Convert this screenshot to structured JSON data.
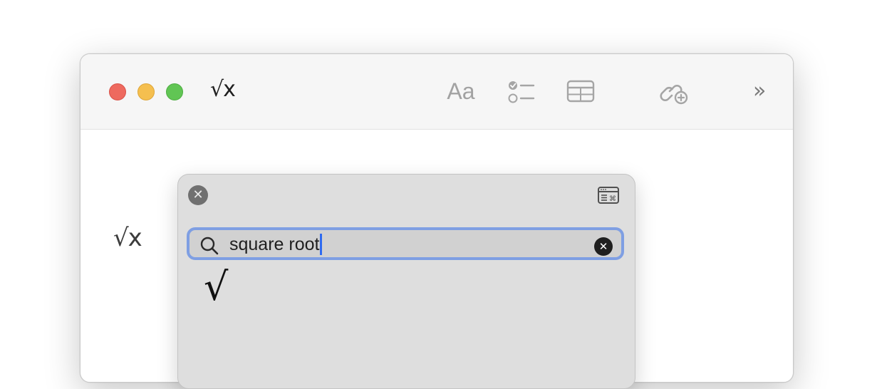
{
  "window": {
    "title": "√x",
    "traffic_lights": [
      "close",
      "minimize",
      "zoom"
    ]
  },
  "toolbar": {
    "text_style_label": "Aa",
    "icons": [
      "text-format-icon",
      "checklist-icon",
      "table-icon",
      "link-add-icon",
      "more-chevrons-icon"
    ],
    "more_label": "»"
  },
  "document": {
    "content": "√x"
  },
  "character_viewer": {
    "search": {
      "value": "square root",
      "placeholder": ""
    },
    "results": [
      "√"
    ]
  },
  "colors": {
    "close": "#ee6a5f",
    "minimize": "#f5bf4f",
    "zoom": "#61c554",
    "focus_ring": "#7f9fe3",
    "caret": "#2f6bf0",
    "viewer_bg": "#dedede"
  }
}
